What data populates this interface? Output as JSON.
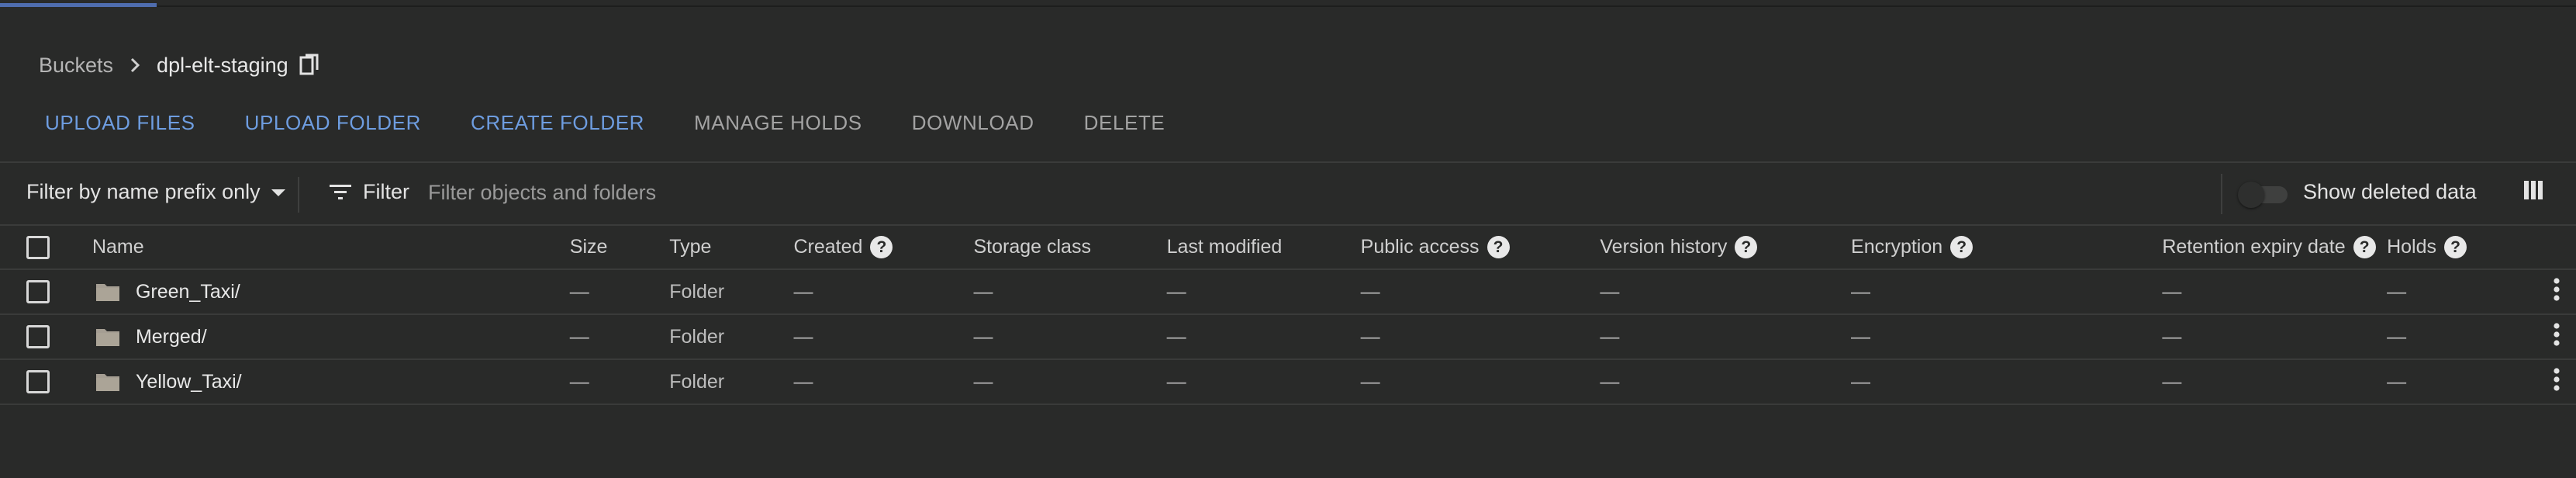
{
  "breadcrumb": {
    "root": "Buckets",
    "current": "dpl-elt-staging"
  },
  "actions": [
    {
      "label": "UPLOAD FILES",
      "enabled": true
    },
    {
      "label": "UPLOAD FOLDER",
      "enabled": true
    },
    {
      "label": "CREATE FOLDER",
      "enabled": true
    },
    {
      "label": "MANAGE HOLDS",
      "enabled": false
    },
    {
      "label": "DOWNLOAD",
      "enabled": false
    },
    {
      "label": "DELETE",
      "enabled": false
    }
  ],
  "filterbar": {
    "prefix_mode": "Filter by name prefix only",
    "filter_label": "Filter",
    "filter_placeholder": "Filter objects and folders",
    "show_deleted_label": "Show deleted data",
    "show_deleted": false
  },
  "table": {
    "columns": {
      "name": "Name",
      "size": "Size",
      "type": "Type",
      "created": "Created",
      "storage_class": "Storage class",
      "last_modified": "Last modified",
      "public_access": "Public access",
      "version_history": "Version history",
      "encryption": "Encryption",
      "retention": "Retention expiry date",
      "holds": "Holds"
    },
    "help_mark": "?",
    "rows": [
      {
        "name": "Green_Taxi/",
        "size": "—",
        "type": "Folder",
        "created": "—",
        "storage_class": "—",
        "last_modified": "—",
        "public_access": "—",
        "version_history": "—",
        "encryption": "—",
        "retention": "—",
        "holds": "—"
      },
      {
        "name": "Merged/",
        "size": "—",
        "type": "Folder",
        "created": "—",
        "storage_class": "—",
        "last_modified": "—",
        "public_access": "—",
        "version_history": "—",
        "encryption": "—",
        "retention": "—",
        "holds": "—"
      },
      {
        "name": "Yellow_Taxi/",
        "size": "—",
        "type": "Folder",
        "created": "—",
        "storage_class": "—",
        "last_modified": "—",
        "public_access": "—",
        "version_history": "—",
        "encryption": "—",
        "retention": "—",
        "holds": "—"
      }
    ]
  },
  "colors": {
    "background": "#292a29",
    "primary_action": "#6e9de0",
    "disabled_action": "#a3a3a3",
    "progress": "#4f6dae"
  },
  "icons": [
    "chevron-right-icon",
    "copy-icon",
    "dropdown-caret-icon",
    "filter-icon",
    "columns-icon",
    "folder-icon",
    "help-icon",
    "more-vert-icon"
  ]
}
